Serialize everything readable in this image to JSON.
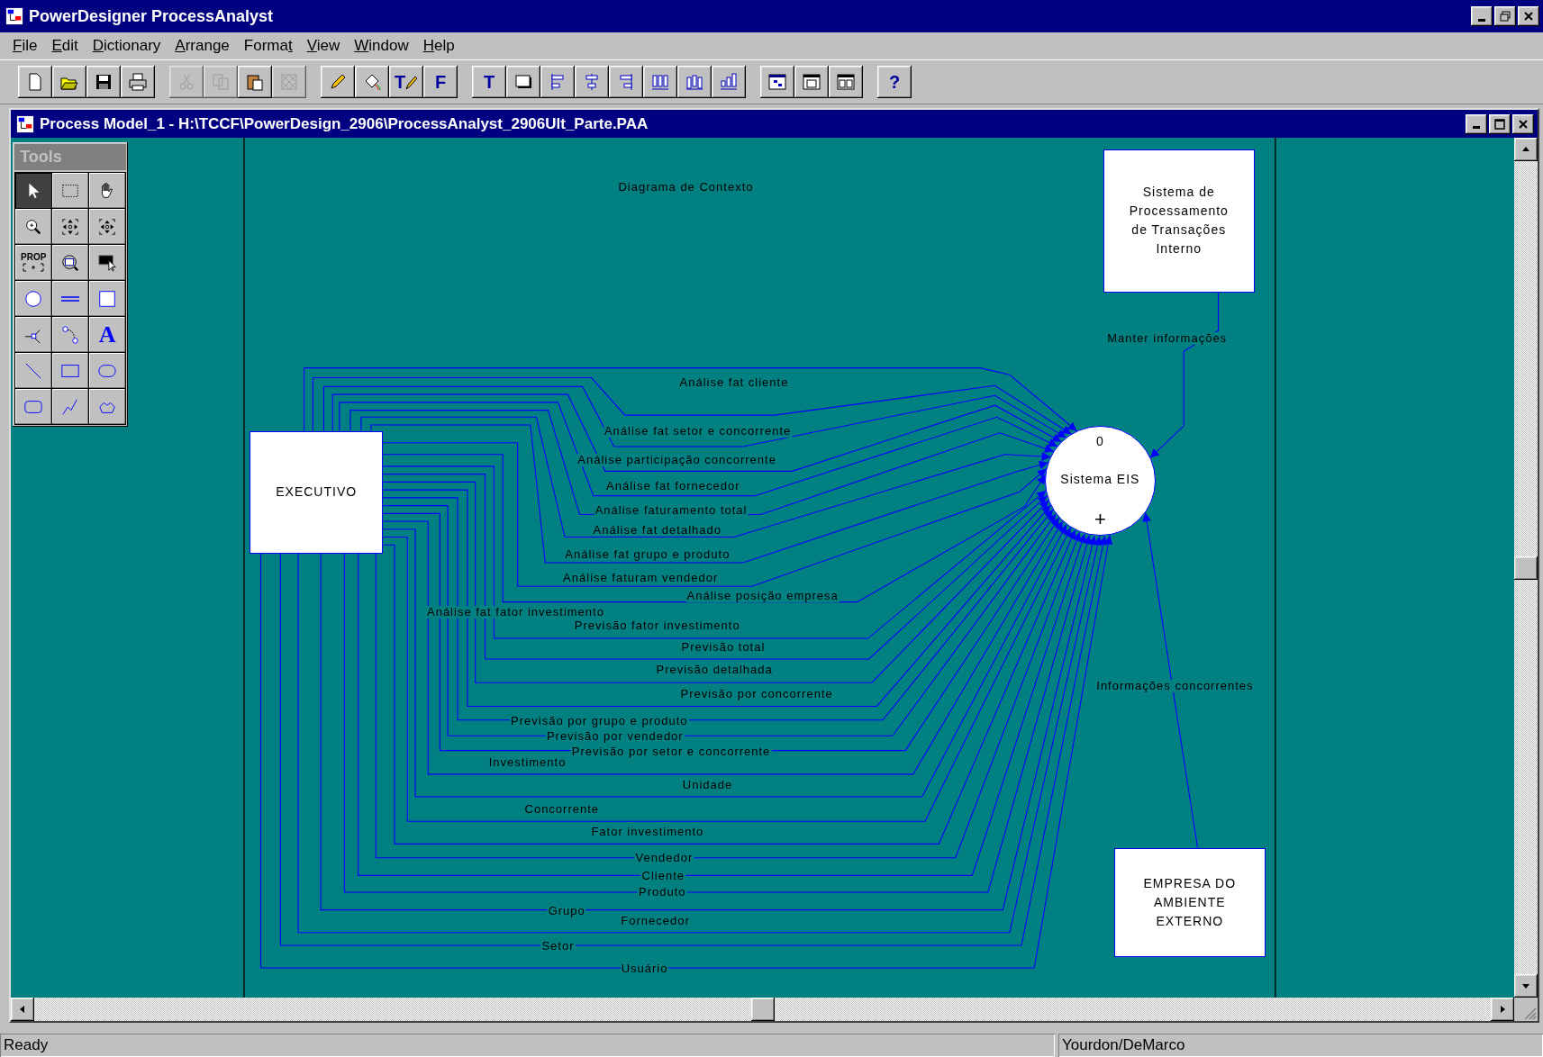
{
  "app_title": "PowerDesigner ProcessAnalyst",
  "menu": [
    {
      "label": "File"
    },
    {
      "label": "Edit"
    },
    {
      "label": "Dictionary"
    },
    {
      "label": "Arrange"
    },
    {
      "label": "Format"
    },
    {
      "label": "View"
    },
    {
      "label": "Window"
    },
    {
      "label": "Help"
    }
  ],
  "toolbar": [
    {
      "disabled": false
    },
    {
      "disabled": false
    },
    {
      "disabled": false
    },
    {
      "disabled": false
    },
    {
      "disabled": true
    },
    {
      "disabled": true
    },
    {
      "disabled": false
    },
    {
      "disabled": true
    },
    {
      "disabled": false
    },
    {
      "disabled": false
    },
    {
      "disabled": false,
      "label": "T"
    },
    {
      "disabled": false,
      "label": "F"
    },
    {
      "disabled": false,
      "label": "T"
    },
    {
      "disabled": false
    },
    {
      "disabled": false
    },
    {
      "disabled": false
    },
    {
      "disabled": false
    },
    {
      "disabled": false
    },
    {
      "disabled": false
    },
    {
      "disabled": false
    },
    {
      "disabled": false
    },
    {
      "disabled": false
    },
    {
      "disabled": false
    },
    {
      "disabled": false,
      "label": "?"
    }
  ],
  "document_title": "Process Model_1 - H:\\TCCF\\PowerDesign_2906\\ProcessAnalyst_2906Ult_Parte.PAA",
  "tools_palette": {
    "title": "Tools",
    "tools": [
      {
        "selected": true
      },
      {
        "selected": false
      },
      {
        "selected": false
      },
      {
        "selected": false
      },
      {
        "selected": false
      },
      {
        "selected": false
      },
      {
        "selected": false,
        "label": "PROP"
      },
      {
        "selected": false
      },
      {
        "selected": false
      },
      {
        "selected": false
      },
      {
        "selected": false
      },
      {
        "selected": false
      },
      {
        "selected": false
      },
      {
        "selected": false
      },
      {
        "selected": false,
        "label": "A"
      },
      {
        "selected": false
      },
      {
        "selected": false
      },
      {
        "selected": false
      },
      {
        "selected": false
      },
      {
        "selected": false
      },
      {
        "selected": false
      }
    ]
  },
  "diagram": {
    "title": "Diagrama de Contexto",
    "process": {
      "number": "0",
      "name": "Sistema EIS",
      "expand_marker": "+"
    },
    "entities": [
      {
        "lines": [
          "EXECUTIVO"
        ]
      },
      {
        "lines": [
          "Sistema de",
          "Processamento",
          "de Transações",
          "Interno"
        ]
      },
      {
        "lines": [
          "EMPRESA DO",
          "AMBIENTE",
          "EXTERNO"
        ]
      }
    ],
    "flows": [
      {
        "label": "Análise fat cliente"
      },
      {
        "label": "Análise fat setor e concorrente"
      },
      {
        "label": "Análise participação concorrente"
      },
      {
        "label": "Análise fat fornecedor"
      },
      {
        "label": "Análise faturamento total"
      },
      {
        "label": "Análise fat detalhado"
      },
      {
        "label": "Análise fat grupo e produto"
      },
      {
        "label": "Análise faturam vendedor"
      },
      {
        "label": "Análise posição empresa"
      },
      {
        "label": "Análise fat fator investimento"
      },
      {
        "label": "Previsão fator investimento"
      },
      {
        "label": "Previsão total"
      },
      {
        "label": "Previsão detalhada"
      },
      {
        "label": "Previsão por concorrente"
      },
      {
        "label": "Previsão por grupo e produto"
      },
      {
        "label": "Previsão por vendedor"
      },
      {
        "label": "Previsão por setor e concorrente"
      },
      {
        "label": "Investimento"
      },
      {
        "label": "Unidade"
      },
      {
        "label": "Concorrente"
      },
      {
        "label": "Fator investimento"
      },
      {
        "label": "Vendedor"
      },
      {
        "label": "Cliente"
      },
      {
        "label": "Produto"
      },
      {
        "label": "Grupo"
      },
      {
        "label": "Fornecedor"
      },
      {
        "label": "Setor"
      },
      {
        "label": "Usuário"
      },
      {
        "label": "Manter informações"
      },
      {
        "label": "Informações concorrentes"
      }
    ]
  },
  "status_bar": {
    "message": "Ready",
    "method": "Yourdon/DeMarco"
  }
}
